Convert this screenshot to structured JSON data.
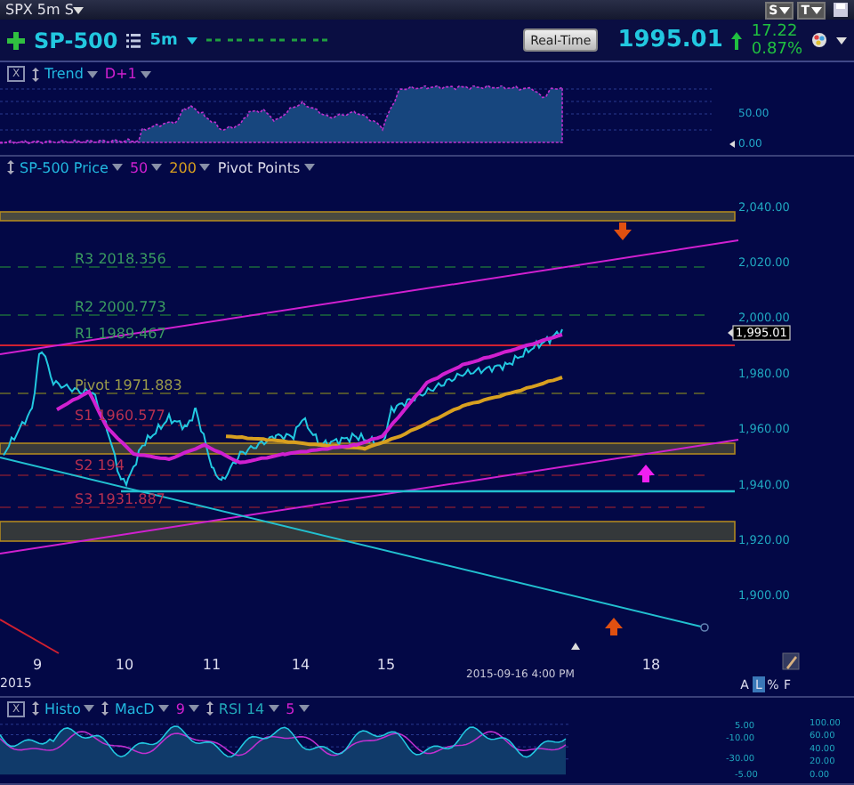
{
  "title_bar": {
    "title": "SPX 5m S",
    "buttons": [
      {
        "label": "S"
      },
      {
        "label": "T"
      }
    ]
  },
  "header": {
    "symbol": "SP-500",
    "interval": "5m",
    "realtime_button": "Real-Time",
    "last_price": "1995.01",
    "change": "17.22",
    "change_pct": "0.87%"
  },
  "trend_panel": {
    "close": "X",
    "studies": [
      {
        "label": "Trend",
        "color": "#22b8e0",
        "grip": true
      },
      {
        "label": "D+1",
        "color": "#d020d0",
        "grip": false
      }
    ],
    "axis_labels": [
      "50.00",
      "0.00"
    ]
  },
  "price_panel": {
    "legend": [
      {
        "label": "SP-500 Price",
        "color": "#22b8e0",
        "grip": true
      },
      {
        "label": "50",
        "color": "#d020d0",
        "grip": false
      },
      {
        "label": "200",
        "color": "#d8a020",
        "grip": false
      },
      {
        "label": "Pivot Points",
        "color": "#d8d8e8",
        "grip": false
      }
    ],
    "pivots": [
      {
        "label": "R3 2018.356",
        "kind": "resistance"
      },
      {
        "label": "R2 2000.773",
        "kind": "resistance"
      },
      {
        "label": "R1 1989.467",
        "kind": "resistance"
      },
      {
        "label": "Pivot 1971.883",
        "kind": "pivot"
      },
      {
        "label": "S1 1960.577",
        "kind": "support"
      },
      {
        "label": "S2 194",
        "kind": "support"
      },
      {
        "label": "S3 1931.887",
        "kind": "support"
      }
    ],
    "y_axis": [
      "2,040.00",
      "2,020.00",
      "2,000.00",
      "1,980.00",
      "1,960.00",
      "1,940.00",
      "1,920.00",
      "1,900.00"
    ],
    "price_marker": "1,995.01",
    "x_axis": [
      "9",
      "10",
      "11",
      "14",
      "15",
      "18"
    ],
    "year": "2015",
    "cursor_time": "2015-09-16 4:00 PM",
    "scale_modes": [
      {
        "label": "A",
        "selected": false
      },
      {
        "label": "L",
        "selected": true
      },
      {
        "label": "%",
        "selected": false
      },
      {
        "label": "F",
        "selected": false
      }
    ]
  },
  "indicator_panel": {
    "close": "X",
    "studies": [
      {
        "label": "Histo",
        "color": "#22b8e0",
        "grip": true
      },
      {
        "label": "MacD",
        "color": "#22b8e0",
        "grip": true
      },
      {
        "label": "9",
        "color": "#d020d0",
        "grip": false
      },
      {
        "label": "RSI 14",
        "color": "#22a8b8",
        "grip": true
      },
      {
        "label": "5",
        "color": "#d020d0",
        "grip": false
      }
    ],
    "macd_axis": [
      "5.00",
      "-10.00",
      "-30.00",
      "-5.00"
    ],
    "rsi_axis": [
      "100.00",
      "60.00",
      "40.00",
      "20.00",
      "0.00"
    ]
  }
}
